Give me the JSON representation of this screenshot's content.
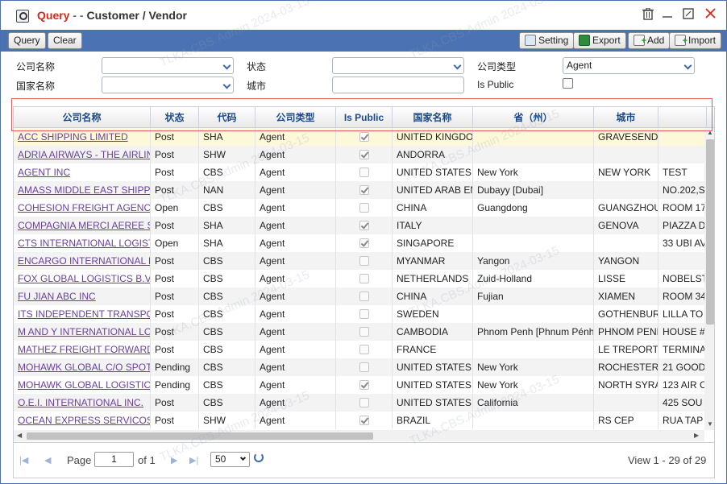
{
  "window": {
    "title_query": "Query",
    "title_sep": "- -",
    "title_rest": "Customer / Vendor",
    "controls": [
      "delete-icon",
      "minimize-icon",
      "maximize-icon",
      "close-icon"
    ]
  },
  "toolbar": {
    "query_label": "Query",
    "clear_label": "Clear",
    "setting_label": "Setting",
    "export_label": "Export",
    "add_label": "Add",
    "import_label": "Import"
  },
  "filters": {
    "company_name_label": "公司名称",
    "company_name_value": "",
    "status_label": "状态",
    "status_value": "",
    "company_type_label": "公司类型",
    "company_type_value": "Agent",
    "country_name_label": "国家名称",
    "country_name_value": "",
    "city_label": "城市",
    "city_value": "",
    "is_public_label": "Is Public",
    "is_public_checked": false
  },
  "grid": {
    "columns": [
      "公司名称",
      "状态",
      "代码",
      "公司类型",
      "Is Public",
      "国家名称",
      "省（州）",
      "城市",
      ""
    ],
    "rows": [
      {
        "name": "ACC SHIPPING LIMITED",
        "status": "Post",
        "code": "SHA",
        "type": "Agent",
        "public": true,
        "country": "UNITED KINGDOM",
        "province": "",
        "city": "GRAVESEND",
        "address": ""
      },
      {
        "name": "ADRIA AIRWAYS - THE AIRLINE",
        "status": "Post",
        "code": "SHW",
        "type": "Agent",
        "public": true,
        "country": "ANDORRA",
        "province": "",
        "city": "",
        "address": ""
      },
      {
        "name": "AGENT INC",
        "status": "Post",
        "code": "CBS",
        "type": "Agent",
        "public": false,
        "country": "UNITED STATES",
        "province": "New York",
        "city": "NEW YORK",
        "address": "TEST"
      },
      {
        "name": "AMASS MIDDLE EAST SHIPPING",
        "status": "Post",
        "code": "NAN",
        "type": "Agent",
        "public": true,
        "country": "UNITED ARAB EMIRATES",
        "province": "Dubayy [Dubai]",
        "city": "",
        "address": "NO.202,S"
      },
      {
        "name": "COHESION FREIGHT AGENCY",
        "status": "Open",
        "code": "CBS",
        "type": "Agent",
        "public": false,
        "country": "CHINA",
        "province": "Guangdong",
        "city": "GUANGZHOU",
        "address": "ROOM 17"
      },
      {
        "name": "COMPAGNIA MERCI AEREE S",
        "status": "Post",
        "code": "SHA",
        "type": "Agent",
        "public": true,
        "country": "ITALY",
        "province": "",
        "city": "GENOVA",
        "address": "PIAZZA D"
      },
      {
        "name": "CTS INTERNATIONAL LOGISTICS",
        "status": "Open",
        "code": "SHA",
        "type": "Agent",
        "public": true,
        "country": "SINGAPORE",
        "province": "",
        "city": "",
        "address": "33 UBI AV"
      },
      {
        "name": "ENCARGO INTERNATIONAL L",
        "status": "Post",
        "code": "CBS",
        "type": "Agent",
        "public": false,
        "country": "MYANMAR",
        "province": "Yangon",
        "city": "YANGON",
        "address": ""
      },
      {
        "name": "FOX GLOBAL LOGISTICS B.V.",
        "status": "Post",
        "code": "CBS",
        "type": "Agent",
        "public": false,
        "country": "NETHERLANDS",
        "province": "Zuid-Holland",
        "city": "LISSE",
        "address": "NOBELSTR"
      },
      {
        "name": "FU JIAN ABC INC",
        "status": "Post",
        "code": "CBS",
        "type": "Agent",
        "public": false,
        "country": "CHINA",
        "province": "Fujian",
        "city": "XIAMEN",
        "address": "ROOM 34"
      },
      {
        "name": "ITS INDEPENDENT TRANSPORT",
        "status": "Post",
        "code": "CBS",
        "type": "Agent",
        "public": false,
        "country": "SWEDEN",
        "province": "",
        "city": "GOTHENBURG",
        "address": "LILLA TO"
      },
      {
        "name": "M AND Y INTERNATIONAL LOG",
        "status": "Post",
        "code": "CBS",
        "type": "Agent",
        "public": false,
        "country": "CAMBODIA",
        "province": "Phnom Penh [Phnum Pénh]",
        "city": "PHNOM PENH",
        "address": "HOUSE #"
      },
      {
        "name": "MATHEZ FREIGHT FORWARDING",
        "status": "Post",
        "code": "CBS",
        "type": "Agent",
        "public": false,
        "country": "FRANCE",
        "province": "",
        "city": "LE TREPORT",
        "address": "TERMINAL"
      },
      {
        "name": "MOHAWK GLOBAL C/O SPOT",
        "status": "Pending",
        "code": "CBS",
        "type": "Agent",
        "public": false,
        "country": "UNITED STATES",
        "province": "New York",
        "city": "ROCHESTER",
        "address": "21 GOOD"
      },
      {
        "name": "MOHAWK GLOBAL LOGISTICS",
        "status": "Pending",
        "code": "CBS",
        "type": "Agent",
        "public": true,
        "country": "UNITED STATES",
        "province": "New York",
        "city": "NORTH SYRACUSE",
        "address": "123 AIR C"
      },
      {
        "name": "O.E.I. INTERNATIONAL INC.",
        "status": "Post",
        "code": "CBS",
        "type": "Agent",
        "public": false,
        "country": "UNITED STATES",
        "province": "California",
        "city": "",
        "address": "425 SOU"
      },
      {
        "name": "OCEAN EXPRESS SERVICOS",
        "status": "Post",
        "code": "SHW",
        "type": "Agent",
        "public": true,
        "country": "BRAZIL",
        "province": "",
        "city": "RS CEP",
        "address": "RUA TAP"
      }
    ]
  },
  "pager": {
    "page_label": "Page",
    "page_value": "1",
    "of_label": "of 1",
    "page_size": "50",
    "summary": "View 1 - 29 of 29"
  },
  "watermark_text": "TLKA.CBS.Admin 2024-03-15"
}
